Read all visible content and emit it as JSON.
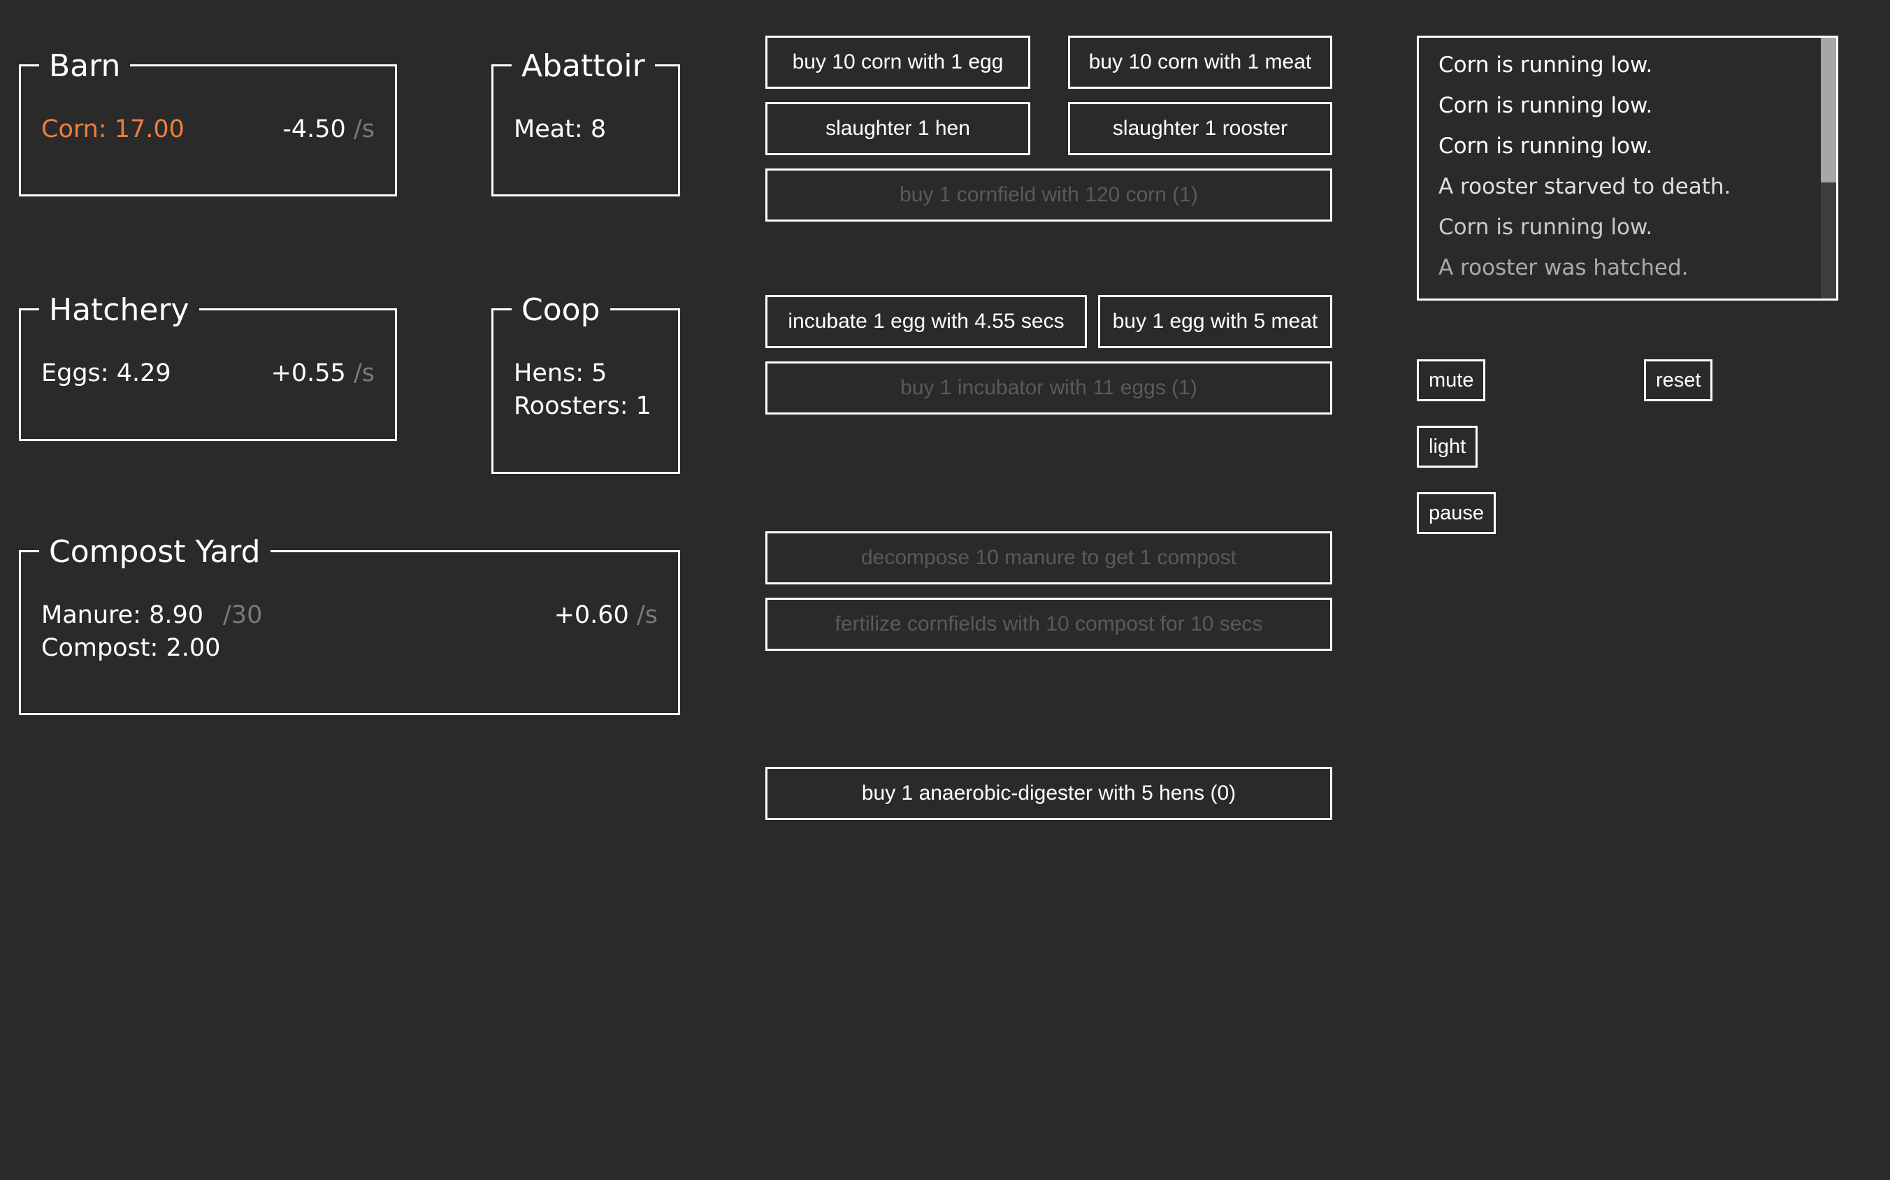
{
  "colors": {
    "background": "#2a2a2a",
    "foreground": "#ffffff",
    "warning": "#ee7f3b",
    "disabled": "#5a5a5a",
    "unit": "#7a7a7a"
  },
  "barn": {
    "title": "Barn",
    "corn": "Corn: 17.00",
    "rate": "-4.50",
    "unit": "/s"
  },
  "abattoir": {
    "title": "Abattoir",
    "meat": "Meat: 8"
  },
  "hatchery": {
    "title": "Hatchery",
    "eggs": "Eggs: 4.29",
    "rate": "+0.55",
    "unit": "/s"
  },
  "coop": {
    "title": "Coop",
    "hens": "Hens: 5",
    "roosters": "Roosters: 1"
  },
  "compost_yard": {
    "title": "Compost Yard",
    "manure": "Manure: 8.90",
    "manure_cap": "/30",
    "compost": "Compost: 2.00",
    "rate": "+0.60",
    "unit": "/s"
  },
  "actions": {
    "buy_corn_egg": "buy 10 corn with 1 egg",
    "buy_corn_meat": "buy 10 corn with 1 meat",
    "slaughter_hen": "slaughter 1 hen",
    "slaughter_rooster": "slaughter 1 rooster",
    "buy_cornfield": "buy 1 cornfield with 120 corn (1)",
    "incubate_egg": "incubate 1 egg with 4.55 secs",
    "buy_egg_meat": "buy 1 egg with 5 meat",
    "buy_incubator": "buy 1 incubator with 11 eggs (1)",
    "decompose_manure": "decompose 10 manure to get 1 compost",
    "fertilize_cornfields": "fertilize cornfields with 10 compost for 10 secs",
    "buy_digester": "buy 1 anaerobic-digester with 5 hens (0)"
  },
  "log": {
    "messages": [
      "Corn is running low.",
      "Corn is running low.",
      "Corn is running low.",
      "A rooster starved to death.",
      "Corn is running low.",
      "A rooster was hatched."
    ],
    "message_opacity": [
      1,
      1,
      1,
      0.85,
      0.75,
      0.6
    ]
  },
  "controls": {
    "mute": "mute",
    "reset": "reset",
    "light": "light",
    "pause": "pause"
  }
}
